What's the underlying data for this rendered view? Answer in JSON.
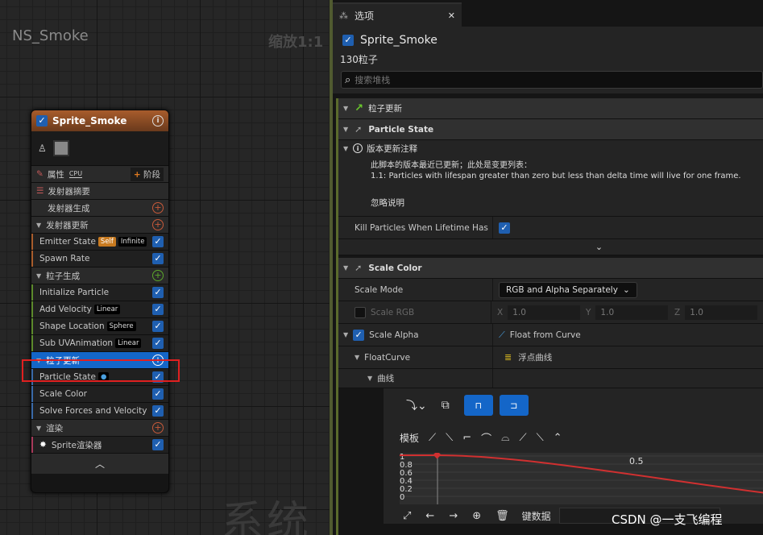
{
  "graph": {
    "title": "NS_Smoke",
    "zoom": "缩放1:1",
    "watermark": "系统"
  },
  "node": {
    "title": "Sprite_Smoke",
    "properties_label": "属性",
    "cpu_badge": "CPU",
    "stage_label": "阶段",
    "summary_label": "发射器摘要",
    "rows": [
      {
        "label": "发射器生成",
        "kind": "section-plain"
      },
      {
        "label": "发射器更新",
        "kind": "section"
      },
      {
        "label": "Emitter State",
        "badges": [
          "Self",
          "Infinite"
        ]
      },
      {
        "label": "Spawn Rate"
      },
      {
        "label": "粒子生成",
        "kind": "section"
      },
      {
        "label": "Initialize Particle"
      },
      {
        "label": "Add Velocity",
        "badges": [
          "Linear"
        ]
      },
      {
        "label": "Shape Location",
        "badges": [
          "Sphere"
        ]
      },
      {
        "label": "Sub UVAnimation",
        "badges": [
          "Linear"
        ]
      },
      {
        "label": "粒子更新",
        "kind": "selected"
      },
      {
        "label": "Particle State"
      },
      {
        "label": "Scale Color"
      },
      {
        "label": "Solve Forces and Velocity"
      },
      {
        "label": "渲染",
        "kind": "section"
      },
      {
        "label": "Sprite渲染器"
      }
    ]
  },
  "panel": {
    "tab_label": "选项",
    "emitter_name": "Sprite_Smoke",
    "particle_count": "130粒子",
    "search_placeholder": "搜索堆栈",
    "particle_update": "粒子更新",
    "particle_state": "Particle State",
    "version_notes": "版本更新注释",
    "note_line1": "此脚本的版本最近已更新；此处是变更列表：",
    "note_line2": "1.1: Particles with lifespan greater than zero but less than delta time will live for one frame.",
    "ignore_note": "忽略说明",
    "kill_particles": "Kill Particles When Lifetime Has",
    "scale_color": "Scale Color",
    "scale_mode": "Scale Mode",
    "scale_mode_value": "RGB and Alpha Separately",
    "scale_rgb": "Scale RGB",
    "x_label": "X",
    "y_label": "Y",
    "z_label": "Z",
    "x_value": "1.0",
    "y_value": "1.0",
    "z_value": "1.0",
    "scale_alpha": "Scale Alpha",
    "float_from_curve": "Float from Curve",
    "float_curve": "FloatCurve",
    "float_curve_value": "浮点曲线",
    "curve": "曲线",
    "template_label": "模板",
    "key_data": "键数据",
    "curve_labels": [
      "1",
      "0.8",
      "0.6",
      "0.4",
      "0.2",
      "0"
    ],
    "curve_x_label": "0.5",
    "watermark": "CSDN @一支飞编程"
  },
  "colors": {
    "selected": "#1466c8",
    "highlight_box": "#e02020",
    "curve": "#d03030",
    "emitter_header": "#a85c2c"
  }
}
